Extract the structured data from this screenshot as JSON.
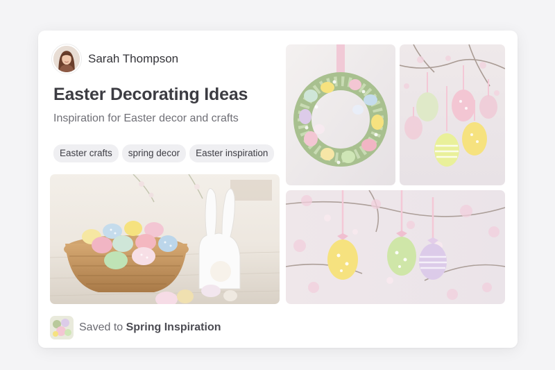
{
  "pin": {
    "author": {
      "name": "Sarah Thompson"
    },
    "title": "Easter Decorating Ideas",
    "description": "Inspiration for Easter decor and crafts",
    "tags": [
      "Easter crafts",
      "spring decor",
      "Easter inspiration"
    ],
    "saved": {
      "prefix": "Saved to",
      "board": "Spring Inspiration"
    }
  },
  "colors": {
    "pastel_pink": "#f3c6d3",
    "pastel_yellow": "#f6e27f",
    "pastel_green": "#cfe6b6",
    "pastel_blue": "#c5dcec",
    "pastel_lilac": "#dccbe9",
    "wicker": "#c89a63"
  }
}
